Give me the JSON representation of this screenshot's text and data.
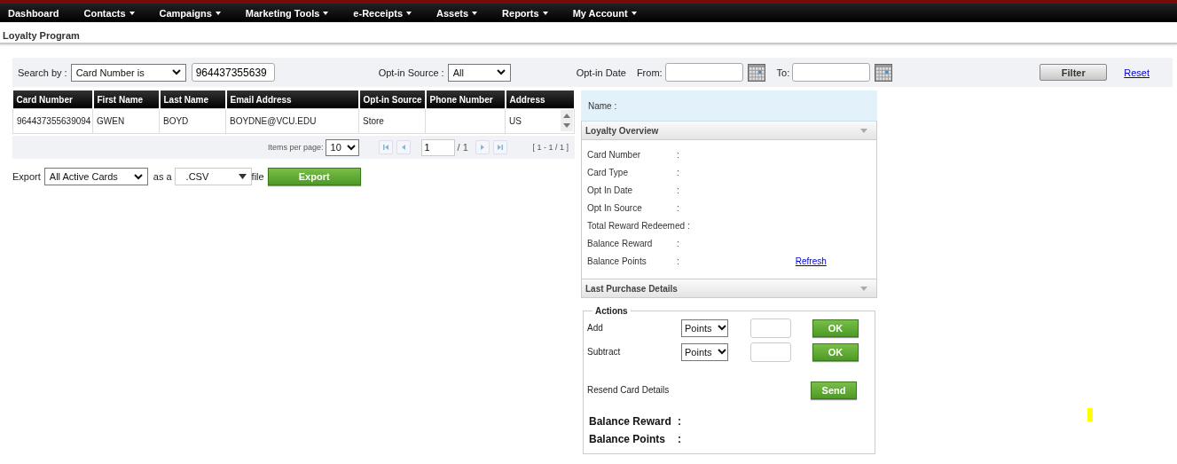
{
  "nav": [
    {
      "label": "Dashboard",
      "dropdown": false
    },
    {
      "label": "Contacts",
      "dropdown": true
    },
    {
      "label": "Campaigns",
      "dropdown": true
    },
    {
      "label": "Marketing Tools",
      "dropdown": true
    },
    {
      "label": "e-Receipts",
      "dropdown": true
    },
    {
      "label": "Assets",
      "dropdown": true
    },
    {
      "label": "Reports",
      "dropdown": true
    },
    {
      "label": "My Account",
      "dropdown": true
    }
  ],
  "page_title": "Loyalty Program",
  "filter": {
    "search_by_label": "Search by :",
    "search_by": "Card Number is",
    "search_value": "964437355639",
    "source_label": "Opt-in Source :",
    "source": "All",
    "date_label": "Opt-in Date",
    "from_label": "From:",
    "to_label": "To:",
    "filter_button": "Filter",
    "reset_link": "Reset"
  },
  "table": {
    "columns": [
      "Card Number",
      "First Name",
      "Last Name",
      "Email Address",
      "Opt-in Source",
      "Phone Number",
      "Address"
    ],
    "rows": [
      [
        "964437355639094",
        "GWEN",
        "BOYD",
        "BOYDNE@VCU.EDU",
        "Store",
        "",
        "US"
      ]
    ]
  },
  "pager": {
    "items_label": "Items per page:",
    "items_per_page": "10",
    "page": "1",
    "page_total": "/ 1",
    "range": "[ 1 - 1 / 1 ]"
  },
  "export": {
    "label": "Export",
    "scope": "All Active Cards",
    "as_label": "as a",
    "format": ".CSV",
    "file_label": "file",
    "button": "Export"
  },
  "details": {
    "name_label": "Name :",
    "sections": [
      {
        "title": "Loyalty Overview",
        "expanded": true,
        "fields": [
          {
            "label": "Card Number",
            "separator": ":"
          },
          {
            "label": "Card Type",
            "separator": ":"
          },
          {
            "label": "Opt In Date",
            "separator": ":"
          },
          {
            "label": "Opt In Source",
            "separator": ":"
          },
          {
            "label": "Total Reward Redeemed",
            "separator": ":"
          },
          {
            "label": "Balance Reward",
            "separator": ":"
          },
          {
            "label": "Balance Points",
            "separator": ":",
            "link": "Refresh"
          }
        ]
      },
      {
        "title": "Last Purchase Details",
        "expanded": false
      }
    ]
  },
  "actions": {
    "legend": "Actions",
    "rows": [
      {
        "kind": "adjust",
        "label": "Add",
        "unit": "Points",
        "button": "OK"
      },
      {
        "kind": "adjust",
        "label": "Subtract",
        "unit": "Points",
        "button": "OK"
      },
      {
        "kind": "send",
        "label": "Resend Card Details",
        "button": "Send"
      }
    ],
    "balances": [
      {
        "label": "Balance Reward",
        "separator": ":"
      },
      {
        "label": "Balance Points",
        "separator": ":"
      }
    ]
  }
}
